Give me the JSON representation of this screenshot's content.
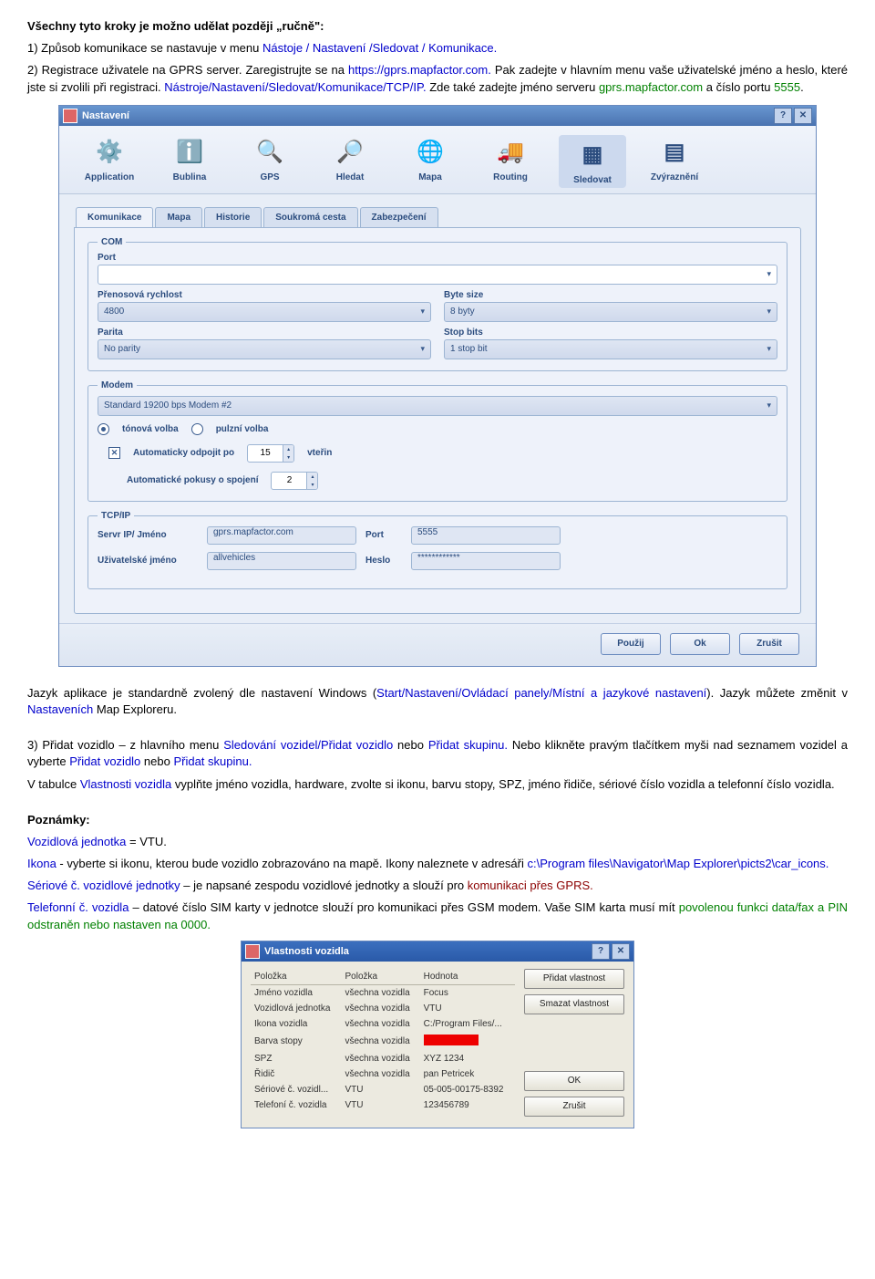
{
  "doc": {
    "p1_intro": "Všechny tyto kroky je možno udělat později „ručně\":",
    "p1_a": "1) Způsob komunikace se nastavuje v menu ",
    "p1_b": "Nástoje / Nastavení /Sledovat / Komunikace.",
    "p2_a": "2) Registrace uživatele na GPRS server. Zaregistrujte se na ",
    "p2_link": " https://gprs.mapfactor.com.",
    "p2_b": " Pak zadejte v hlavním menu vaše uživatelské jméno a heslo, které jste si zvolili při registraci. ",
    "p2_c": "Nástroje/Nastavení/Sledovat/Komunikace/TCP/IP.",
    "p2_d": " Zde také zadejte jméno serveru ",
    "p2_e": "gprs.mapfactor.com",
    "p2_f": " a číslo portu ",
    "p2_g": "5555",
    "p2_h": ".",
    "p3_a": "Jazyk aplikace je standardně zvolený dle nastavení Windows  (",
    "p3_b": "Start/Nastavení/Ovládací panely/Místní a jazykové nastavení",
    "p3_c": "). Jazyk můžete změnit v ",
    "p3_d": "Nastaveních",
    "p3_e": " Map Exploreru.",
    "p4_a": "3) Přidat vozidlo – z hlavního menu ",
    "p4_b": "Sledování vozidel/Přidat vozidlo",
    "p4_c": " nebo ",
    "p4_d": "Přidat skupinu.",
    "p4_e": " Nebo klikněte pravým tlačítkem myši nad seznamem vozidel a vyberte ",
    "p4_f": "Přidat vozidlo",
    "p4_g": " nebo ",
    "p4_h": "Přidat skupinu.",
    "p5_a": "V tabulce ",
    "p5_b": "Vlastnosti vozidla",
    "p5_c": " vyplňte jméno vozidla, hardware, zvolte si ikonu, barvu stopy, SPZ, jméno řidiče, sériové číslo vozidla a telefonní číslo vozidla.",
    "p6": "Poznámky:",
    "p7_a": "Vozidlová jednotka",
    "p7_b": " = VTU.",
    "p8_a": "Ikona",
    "p8_b": " - vyberte si ikonu, kterou bude vozidlo zobrazováno na mapě. Ikony naleznete v adresáři  ",
    "p8_c": "c:\\Program files\\Navigator\\Map Explorer\\picts2\\car_icons.",
    "p9_a": "Sériové č. vozidlové jednotky",
    "p9_b": " – je napsané zespodu vozidlové jednotky a slouží pro ",
    "p9_c": "komunikaci přes GPRS.",
    "p10_a": "Telefonní č. vozidla",
    "p10_b": " – datové číslo SIM karty v jednotce slouží pro komunikaci přes GSM modem. Vaše SIM karta musí mít ",
    "p10_c": "povolenou funkci data/fax a PIN odstraněn nebo nastaven na 0000."
  },
  "dialog": {
    "title": "Nastavení",
    "toolbar": [
      {
        "label": "Application",
        "glyph": "⚙️"
      },
      {
        "label": "Bublina",
        "glyph": "ℹ️"
      },
      {
        "label": "GPS",
        "glyph": "🔍"
      },
      {
        "label": "Hledat",
        "glyph": "🔎"
      },
      {
        "label": "Mapa",
        "glyph": "🌐"
      },
      {
        "label": "Routing",
        "glyph": "🚚"
      },
      {
        "label": "Sledovat",
        "glyph": "▦",
        "active": true
      },
      {
        "label": "Zvýraznění",
        "glyph": "▤"
      }
    ],
    "tabs": [
      "Komunikace",
      "Mapa",
      "Historie",
      "Soukromá cesta",
      "Zabezpečení"
    ],
    "com": {
      "legend": "COM",
      "port_lbl": "Port",
      "baud_lbl": "Přenosová rychlost",
      "baud_val": "4800",
      "byte_lbl": "Byte size",
      "byte_val": "8 byty",
      "parity_lbl": "Parita",
      "parity_val": "No parity",
      "stop_lbl": "Stop bits",
      "stop_val": "1 stop bit"
    },
    "modem": {
      "legend": "Modem",
      "device": "Standard 19200 bps Modem #2",
      "tone": "tónová volba",
      "pulse": "pulzní volba",
      "auto_lbl": "Automaticky odpojit po",
      "auto_val": "15",
      "auto_unit": "vteřin",
      "retry_lbl": "Automatické pokusy o spojení",
      "retry_val": "2"
    },
    "tcpip": {
      "legend": "TCP/IP",
      "server_lbl": "Servr IP/ Jméno",
      "server_val": "gprs.mapfactor.com",
      "port_lbl": "Port",
      "port_val": "5555",
      "user_lbl": "Uživatelské jméno",
      "user_val": "allvehicles",
      "pass_lbl": "Heslo",
      "pass_val": "************"
    },
    "footer": {
      "apply": "Použij",
      "ok": "Ok",
      "cancel": "Zrušit"
    }
  },
  "vehicle": {
    "title": "Vlastnosti vozidla",
    "headers": [
      "Položka",
      "Položka",
      "Hodnota"
    ],
    "rows": [
      {
        "a": "Jméno vozidla",
        "b": "všechna vozidla",
        "c": "Focus"
      },
      {
        "a": "Vozidlová jednotka",
        "b": "všechna vozidla",
        "c": "VTU"
      },
      {
        "a": "Ikona vozidla",
        "b": "všechna vozidla",
        "c": "C:/Program Files/..."
      },
      {
        "a": "Barva stopy",
        "b": "všechna vozidla",
        "c": "__RED__"
      },
      {
        "a": "SPZ",
        "b": "všechna vozidla",
        "c": "XYZ 1234"
      },
      {
        "a": "Řidič",
        "b": "všechna vozidla",
        "c": "pan Petricek"
      },
      {
        "a": "Sériové č. vozidl...",
        "b": "VTU",
        "c": "05-005-00175-8392"
      },
      {
        "a": "Telefoní č. vozidla",
        "b": "VTU",
        "c": "123456789"
      }
    ],
    "btns": {
      "add": "Přidat vlastnost",
      "del": "Smazat vlastnost",
      "ok": "OK",
      "cancel": "Zrušit"
    }
  }
}
